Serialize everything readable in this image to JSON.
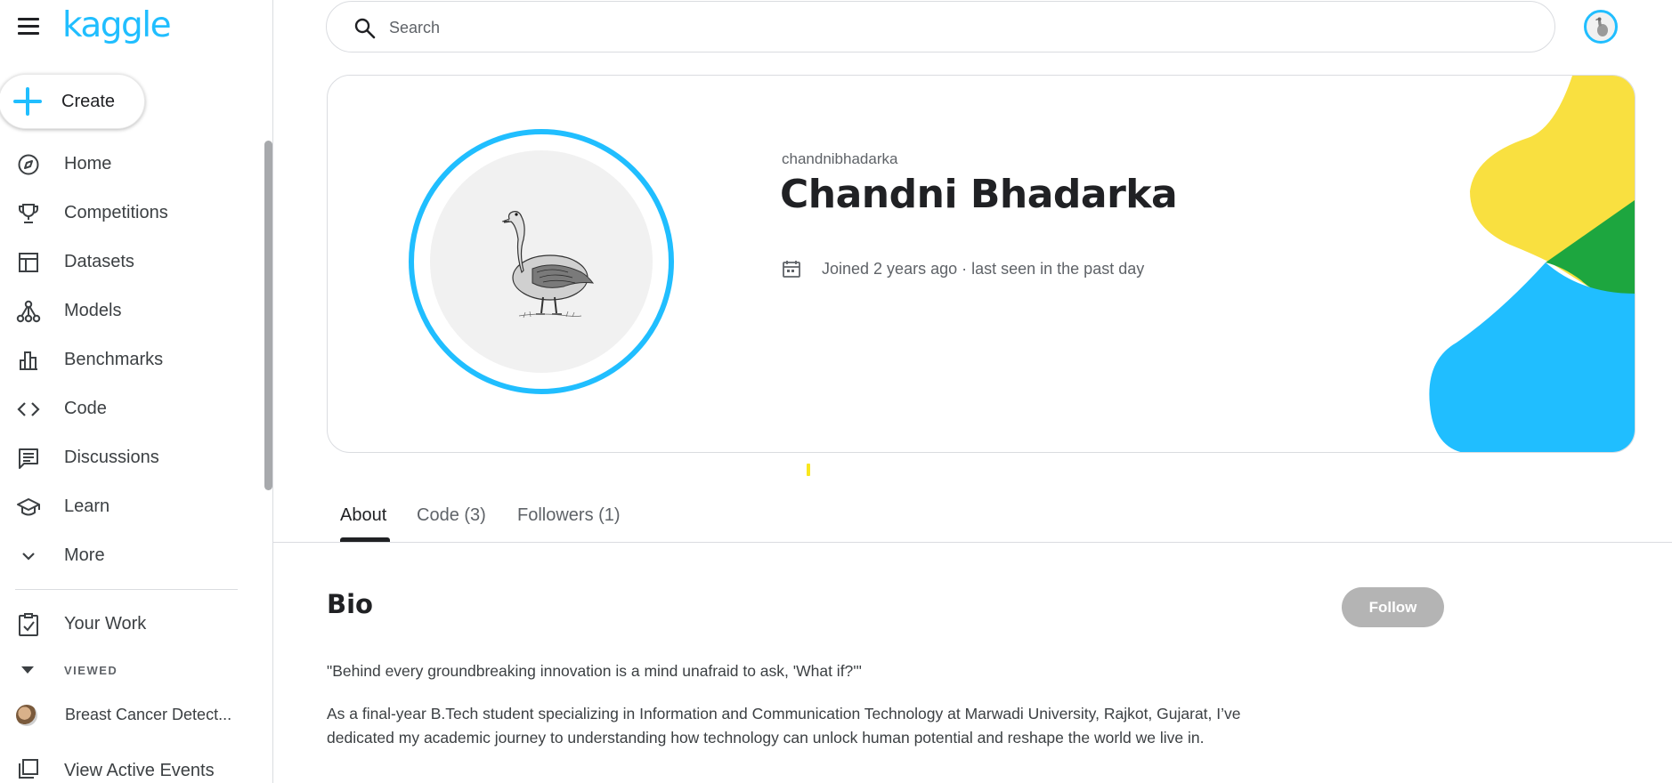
{
  "sidebar": {
    "logo": "kaggle",
    "create_label": "Create",
    "items": [
      {
        "label": "Home",
        "icon": "compass-icon"
      },
      {
        "label": "Competitions",
        "icon": "trophy-icon"
      },
      {
        "label": "Datasets",
        "icon": "table-icon"
      },
      {
        "label": "Models",
        "icon": "models-icon"
      },
      {
        "label": "Benchmarks",
        "icon": "bar-chart-icon"
      },
      {
        "label": "Code",
        "icon": "code-icon"
      },
      {
        "label": "Discussions",
        "icon": "comment-icon"
      },
      {
        "label": "Learn",
        "icon": "school-icon"
      },
      {
        "label": "More",
        "icon": "chevron-down-icon"
      }
    ],
    "your_work": "Your Work",
    "viewed_heading": "VIEWED",
    "recent_item": "Breast Cancer Detect...",
    "active_events": "View Active Events"
  },
  "header": {
    "search_placeholder": "Search"
  },
  "profile": {
    "username": "chandnibhadarka",
    "full_name": "Chandni Bhadarka",
    "joined": "Joined 2 years ago · last seen in the past day"
  },
  "tabs": [
    {
      "label": "About",
      "active": true
    },
    {
      "label": "Code (3)",
      "active": false
    },
    {
      "label": "Followers (1)",
      "active": false
    }
  ],
  "bio": {
    "title": "Bio",
    "follow_label": "Follow",
    "quote": "\"Behind every groundbreaking innovation is a mind unafraid to ask, 'What if?'\"",
    "paragraph": "As a final-year B.Tech student specializing in Information and Communication Technology at Marwadi University, Rajkot, Gujarat, I’ve dedicated my academic journey to understanding how technology can unlock human potential and reshape the world we live in."
  },
  "colors": {
    "brand": "#20beff",
    "decor_yellow": "#f9e040",
    "decor_green": "#1da63f",
    "decor_blue": "#20beff"
  }
}
